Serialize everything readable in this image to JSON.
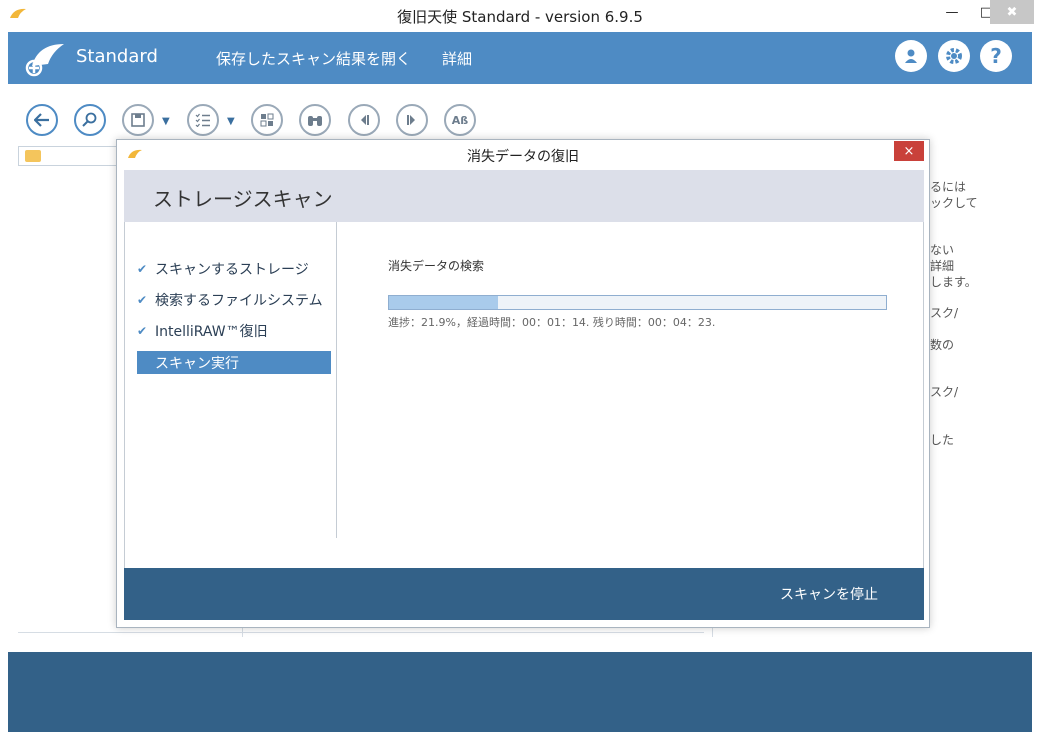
{
  "window": {
    "title": "復旧天使 Standard - version 6.9.5",
    "min": "—",
    "max": "□",
    "close": "✖"
  },
  "header": {
    "brand": "Standard",
    "nav_open": "保存したスキャン結果を開く",
    "nav_detail": "詳細",
    "user_icon": "user-icon",
    "gear_icon": "gear-icon",
    "help_icon": "help-icon",
    "help_glyph": "?"
  },
  "toolbar": {
    "caret": "▼",
    "ab_label": "Aß"
  },
  "right_panel": {
    "lines": [
      "るには",
      "ックして",
      "ない",
      "詳細",
      "します。",
      "スク/",
      "数の",
      "スク/",
      "した"
    ]
  },
  "dialog": {
    "title": "消失データの復旧",
    "close": "×",
    "heading": "ストレージスキャン",
    "steps": [
      {
        "label": "スキャンするストレージ",
        "done": true
      },
      {
        "label": "検索するファイルシステム",
        "done": true
      },
      {
        "label": "IntelliRAW™復旧",
        "done": true
      },
      {
        "label": "スキャン実行",
        "done": false
      }
    ],
    "check_glyph": "✔",
    "search_label": "消失データの検索",
    "progress_fraction": 0.219,
    "progress_text": "進捗：21.9%，経過時間：00：01：14.   残り時間：00：04：23.",
    "stop_button": "スキャンを停止"
  },
  "colors": {
    "accent": "#4e8bc4",
    "dark": "#336188"
  }
}
